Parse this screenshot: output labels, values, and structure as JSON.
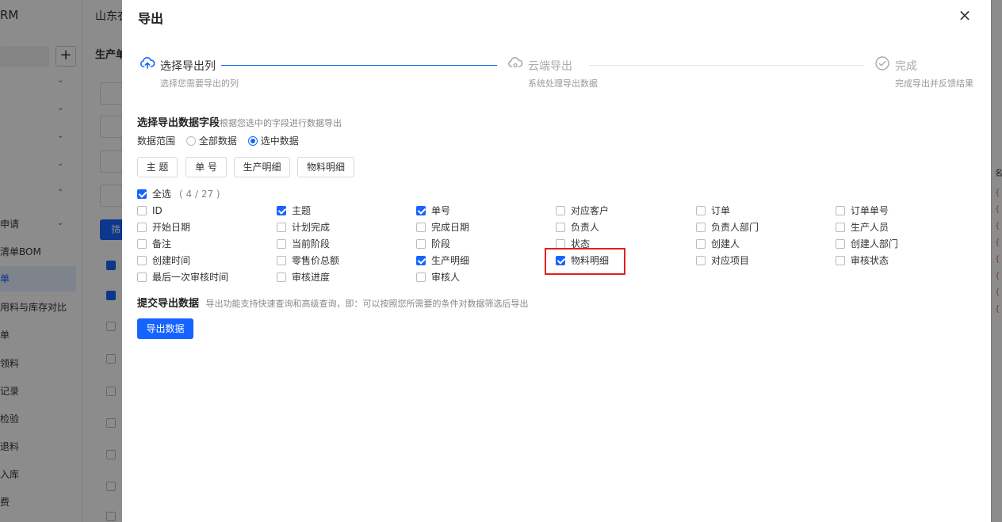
{
  "background": {
    "logo": "RM",
    "tab": "山东衣",
    "section_title": "生产单",
    "filter_btn": "筛",
    "menu": [
      "申请",
      "清单BOM",
      "单",
      "用料与库存对比",
      "单",
      "领料",
      "记录",
      "检验",
      "退料",
      "入库",
      "费"
    ],
    "right_letter": "名"
  },
  "dialog": {
    "title": "导出",
    "close": "×",
    "steps": [
      {
        "label": "选择导出列",
        "desc": "选择您需要导出的列"
      },
      {
        "label": "云端导出",
        "desc": "系统处理导出数据"
      },
      {
        "label": "完成",
        "desc": "完成导出并反馈结果"
      }
    ],
    "select_title": "选择导出数据字段",
    "select_sub": "根据您选中的字段进行数据导出",
    "range_label": "数据范围",
    "range_options": [
      "全部数据",
      "选中数据"
    ],
    "range_selected": "选中数据",
    "tag_buttons": [
      "主 题",
      "单 号",
      "生产明细",
      "物料明细"
    ],
    "select_all_label": "全选",
    "select_all_count": "( 4 / 27 )",
    "fields": [
      {
        "label": "ID",
        "checked": false
      },
      {
        "label": "主题",
        "checked": true
      },
      {
        "label": "单号",
        "checked": true
      },
      {
        "label": "对应客户",
        "checked": false
      },
      {
        "label": "订单",
        "checked": false
      },
      {
        "label": "订单单号",
        "checked": false
      },
      {
        "label": "开始日期",
        "checked": false
      },
      {
        "label": "计划完成",
        "checked": false
      },
      {
        "label": "完成日期",
        "checked": false
      },
      {
        "label": "负责人",
        "checked": false
      },
      {
        "label": "负责人部门",
        "checked": false
      },
      {
        "label": "生产人员",
        "checked": false
      },
      {
        "label": "备注",
        "checked": false
      },
      {
        "label": "当前阶段",
        "checked": false
      },
      {
        "label": "阶段",
        "checked": false
      },
      {
        "label": "状态",
        "checked": false
      },
      {
        "label": "创建人",
        "checked": false
      },
      {
        "label": "创建人部门",
        "checked": false
      },
      {
        "label": "创建时间",
        "checked": false
      },
      {
        "label": "零售价总额",
        "checked": false
      },
      {
        "label": "生产明细",
        "checked": true
      },
      {
        "label": "物料明细",
        "checked": true
      },
      {
        "label": "对应项目",
        "checked": false
      },
      {
        "label": "审核状态",
        "checked": false
      },
      {
        "label": "最后一次审核时间",
        "checked": false
      },
      {
        "label": "审核进度",
        "checked": false
      },
      {
        "label": "审核人",
        "checked": false
      }
    ],
    "submit_title": "提交导出数据",
    "submit_sub": "导出功能支持快速查询和高级查询，即：可以按照您所需要的条件对数据筛选后导出",
    "export_button": "导出数据"
  }
}
